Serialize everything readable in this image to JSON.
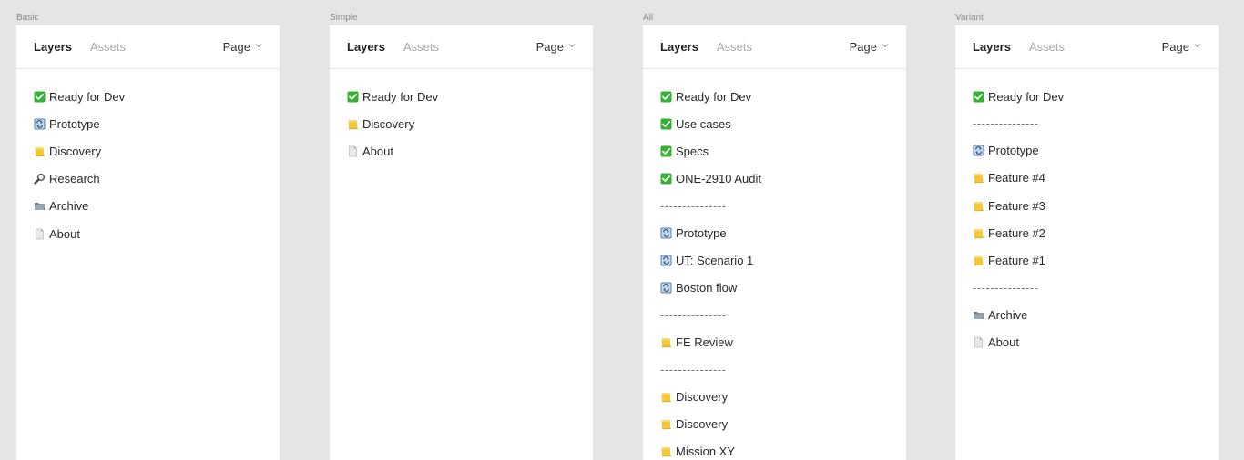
{
  "header": {
    "tab_layers": "Layers",
    "tab_assets": "Assets",
    "page_label": "Page"
  },
  "colors": {
    "check_green": "#34b233",
    "folder_yellow": "#f2c738",
    "prototype_blue": "#5b7fa8"
  },
  "frames": [
    {
      "label": "Basic",
      "items": [
        {
          "icon": "check-icon",
          "text": "Ready for Dev"
        },
        {
          "icon": "prototype-icon",
          "text": "Prototype"
        },
        {
          "icon": "folder-icon",
          "text": "Discovery"
        },
        {
          "icon": "magnifier-icon",
          "text": "Research"
        },
        {
          "icon": "archive-icon",
          "text": "Archive"
        },
        {
          "icon": "document-icon",
          "text": "About"
        }
      ]
    },
    {
      "label": "Simple",
      "items": [
        {
          "icon": "check-icon",
          "text": "Ready for Dev"
        },
        {
          "icon": "folder-icon",
          "text": "Discovery"
        },
        {
          "icon": "document-icon",
          "text": "About"
        }
      ]
    },
    {
      "label": "All",
      "items": [
        {
          "icon": "check-icon",
          "text": "Ready for Dev"
        },
        {
          "icon": "check-icon",
          "text": "Use cases"
        },
        {
          "icon": "check-icon",
          "text": "Specs"
        },
        {
          "icon": "check-icon",
          "text": "ONE-2910 Audit"
        },
        {
          "icon": "",
          "text": "---------------"
        },
        {
          "icon": "prototype-icon",
          "text": "Prototype"
        },
        {
          "icon": "prototype-icon",
          "text": "UT: Scenario 1"
        },
        {
          "icon": "prototype-icon",
          "text": "Boston flow"
        },
        {
          "icon": "",
          "text": "---------------"
        },
        {
          "icon": "folder-icon",
          "text": "FE Review"
        },
        {
          "icon": "",
          "text": "---------------"
        },
        {
          "icon": "folder-icon",
          "text": "Discovery"
        },
        {
          "icon": "folder-icon",
          "text": "Discovery"
        },
        {
          "icon": "folder-icon",
          "text": "Mission XY"
        }
      ]
    },
    {
      "label": "Variant",
      "items": [
        {
          "icon": "check-icon",
          "text": "Ready for Dev"
        },
        {
          "icon": "",
          "text": "---------------"
        },
        {
          "icon": "prototype-icon",
          "text": "Prototype"
        },
        {
          "icon": "folder-icon",
          "text": "Feature #4"
        },
        {
          "icon": "folder-icon",
          "text": "Feature #3"
        },
        {
          "icon": "folder-icon",
          "text": "Feature #2"
        },
        {
          "icon": "folder-icon",
          "text": "Feature #1"
        },
        {
          "icon": "",
          "text": "---------------"
        },
        {
          "icon": "archive-icon",
          "text": "Archive"
        },
        {
          "icon": "document-icon",
          "text": "About"
        }
      ]
    }
  ]
}
